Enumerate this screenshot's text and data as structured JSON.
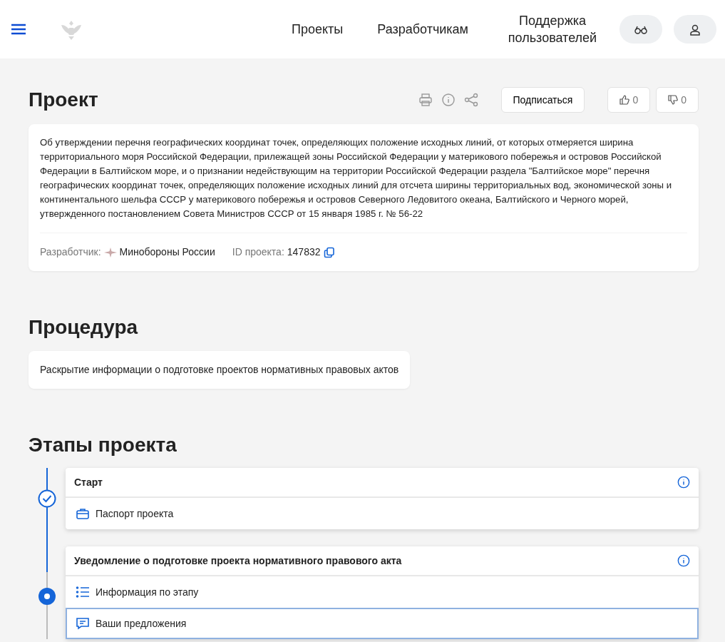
{
  "header": {
    "nav": [
      "Проекты",
      "Разработчикам",
      "Поддержка пользователей"
    ]
  },
  "project": {
    "title": "Проект",
    "subscribe": "Подписаться",
    "likes": "0",
    "dislikes": "0",
    "description": "Об утверждении перечня географических координат точек, определяющих положение исходных линий, от которых отмеряется ширина территориального моря Российской Федерации, прилежащей зоны Российской Федерации у материкового побережья и островов Российской Федерации в Балтийском море, и о признании недействующим на территории Российской Федерации раздела \"Балтийское море\" перечня географических координат точек, определяющих положение исходных линий для отсчета ширины территориальных вод, экономической зоны и континентального шельфа СССР у материкового побережья и островов Северного Ледовитого океана, Балтийского и Черного морей, утвержденного постановлением Совета Министров СССР от 15 января 1985 г. № 56-22",
    "developer_label": "Разработчик:",
    "developer": "Минобороны России",
    "id_label": "ID проекта:",
    "id": "147832"
  },
  "procedure": {
    "title": "Процедура",
    "text": "Раскрытие информации о подготовке проектов нормативных правовых актов"
  },
  "stages": {
    "title": "Этапы проекта",
    "items": [
      {
        "kind": "done",
        "title": "Старт",
        "links": [
          {
            "kind": "passport",
            "label": "Паспорт проекта",
            "selected": false
          }
        ]
      },
      {
        "kind": "current",
        "title": "Уведомление о подготовке проекта нормативного правового акта",
        "links": [
          {
            "kind": "info",
            "label": "Информация по этапу",
            "selected": false
          },
          {
            "kind": "proposals",
            "label": "Ваши предложения",
            "selected": true
          }
        ]
      }
    ]
  }
}
